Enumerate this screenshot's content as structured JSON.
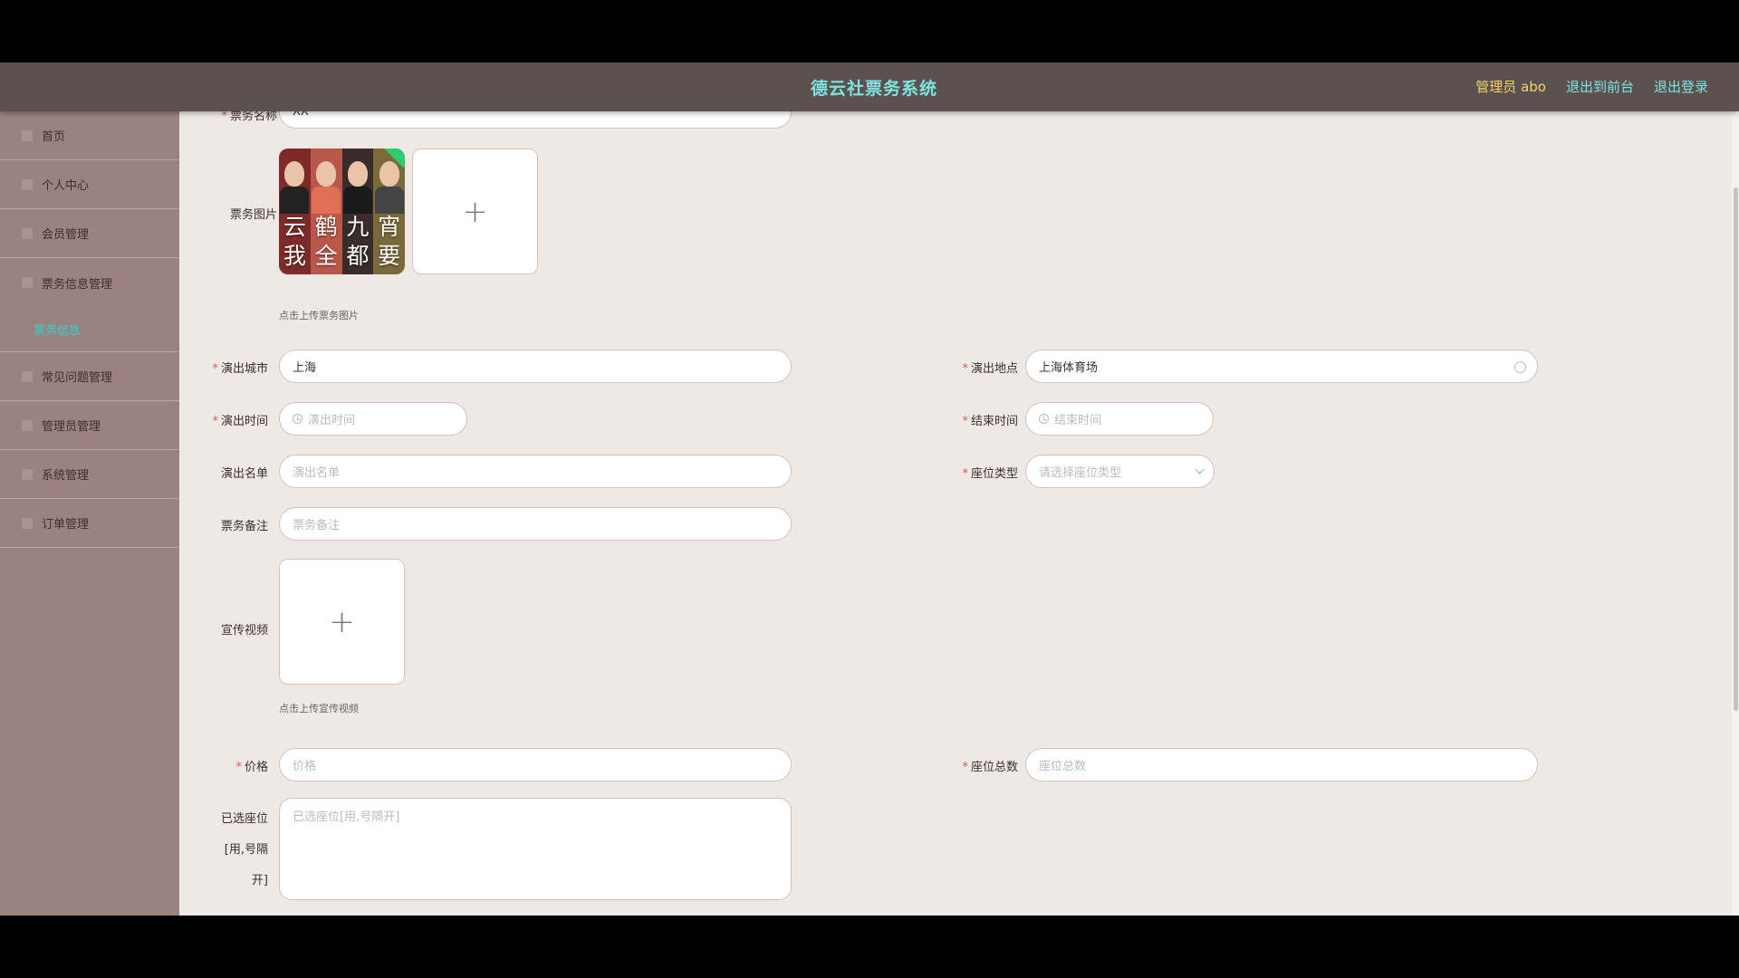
{
  "header": {
    "title": "德云社票务系统",
    "admin": "管理员 abo",
    "exit_front": "退出到前台",
    "logout": "退出登录"
  },
  "sidebar": {
    "items": [
      {
        "label": "首页"
      },
      {
        "label": "个人中心"
      },
      {
        "label": "会员管理"
      },
      {
        "label": "票务信息管理"
      },
      {
        "label": "票务信息"
      },
      {
        "label": "常见问题管理"
      },
      {
        "label": "管理员管理"
      },
      {
        "label": "系统管理"
      },
      {
        "label": "订单管理"
      }
    ]
  },
  "form": {
    "name": {
      "label": "票务名称",
      "value": "XX"
    },
    "image": {
      "label": "票务图片",
      "hint": "点击上传票务图片",
      "thumb_chars": [
        "云",
        "我",
        "鹤",
        "全",
        "九",
        "都",
        "宵",
        "要"
      ]
    },
    "city": {
      "label": "演出城市",
      "value": "上海"
    },
    "venue": {
      "label": "演出地点",
      "value": "上海体育场"
    },
    "start_time": {
      "label": "演出时间",
      "placeholder": "演出时间"
    },
    "end_time": {
      "label": "结束时间",
      "placeholder": "结束时间"
    },
    "cast": {
      "label": "演出名单",
      "placeholder": "演出名单"
    },
    "seat_type": {
      "label": "座位类型",
      "placeholder": "请选择座位类型"
    },
    "remark": {
      "label": "票务备注",
      "placeholder": "票务备注"
    },
    "video": {
      "label": "宣传视频",
      "hint": "点击上传宣传视频"
    },
    "price": {
      "label": "价格",
      "placeholder": "价格"
    },
    "seat_total": {
      "label": "座位总数",
      "placeholder": "座位总数"
    },
    "selected_seats": {
      "label_lines": [
        "已选座位",
        "[用,号隔",
        "开]"
      ],
      "placeholder": "已选座位[用,号隔开]"
    }
  },
  "colors": {
    "topbar": "#5b514e",
    "sidebar": "#9b827f",
    "accent": "#7fe3e1",
    "admin": "#f2d36b",
    "required": "#e05a4f"
  }
}
